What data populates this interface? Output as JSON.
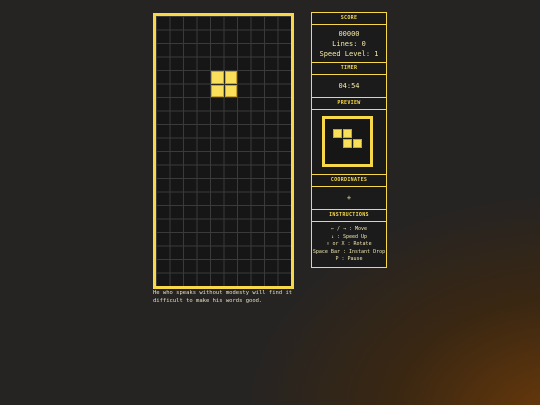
{
  "board": {
    "cols": 10,
    "rows": 20,
    "active_piece": {
      "type": "O",
      "cells": [
        [
          4,
          4
        ],
        [
          5,
          4
        ],
        [
          4,
          5
        ],
        [
          5,
          5
        ]
      ]
    }
  },
  "quote": "He who speaks without modesty will find it difficult to make his words good.",
  "panel": {
    "score_title": "SCORE",
    "score": "00000",
    "lines": "Lines: 0",
    "speed": "Speed Level: 1",
    "timer_title": "TIMER",
    "timer": "04:54",
    "preview_title": "PREVIEW",
    "preview_piece": {
      "type": "Z",
      "cells": [
        [
          0,
          0
        ],
        [
          1,
          0
        ],
        [
          1,
          1
        ],
        [
          2,
          1
        ]
      ]
    },
    "coordinates_title": "COORDINATES",
    "coordinates_value": "+",
    "instructions_title": "INSTRUCTIONS",
    "instructions": [
      "← / → : Move",
      "↓ : Speed Up",
      "↑ or X : Rotate",
      "Space Bar : Instant Drop",
      "P : Pause"
    ]
  },
  "colors": {
    "accent": "#f7d84a",
    "piece": "#f9df5a",
    "board_bg": "#161616"
  }
}
